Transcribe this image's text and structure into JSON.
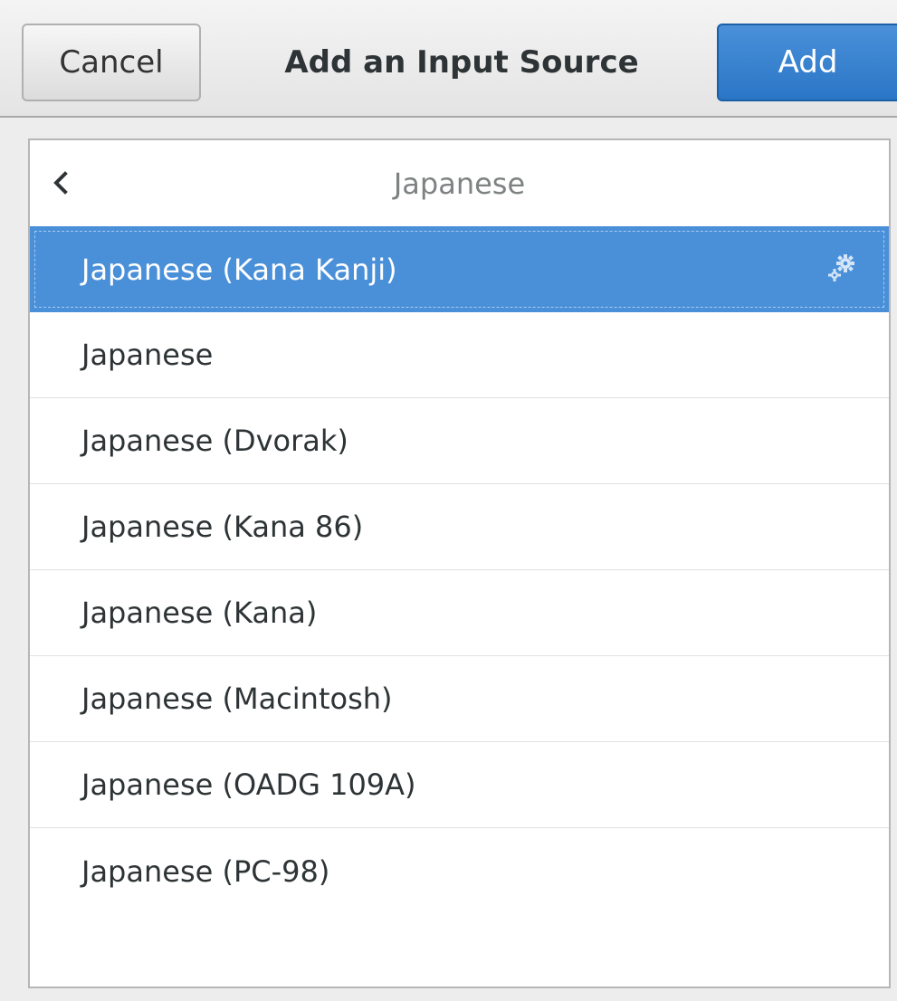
{
  "window": {
    "title": "Add an Input Source"
  },
  "header": {
    "cancel_label": "Cancel",
    "add_label": "Add"
  },
  "list": {
    "heading": "Japanese",
    "back_icon": "chevron-left-icon",
    "items": [
      {
        "label": "Japanese (Kana Kanji)",
        "selected": true,
        "icon": "settings-gears-icon"
      },
      {
        "label": "Japanese",
        "selected": false
      },
      {
        "label": "Japanese (Dvorak)",
        "selected": false
      },
      {
        "label": "Japanese (Kana 86)",
        "selected": false
      },
      {
        "label": "Japanese (Kana)",
        "selected": false
      },
      {
        "label": "Japanese (Macintosh)",
        "selected": false
      },
      {
        "label": "Japanese (OADG 109A)",
        "selected": false
      },
      {
        "label": "Japanese (PC-98)",
        "selected": false
      }
    ]
  },
  "colors": {
    "accent": "#4a90d9",
    "background": "#ededed",
    "list_background": "#ffffff"
  }
}
